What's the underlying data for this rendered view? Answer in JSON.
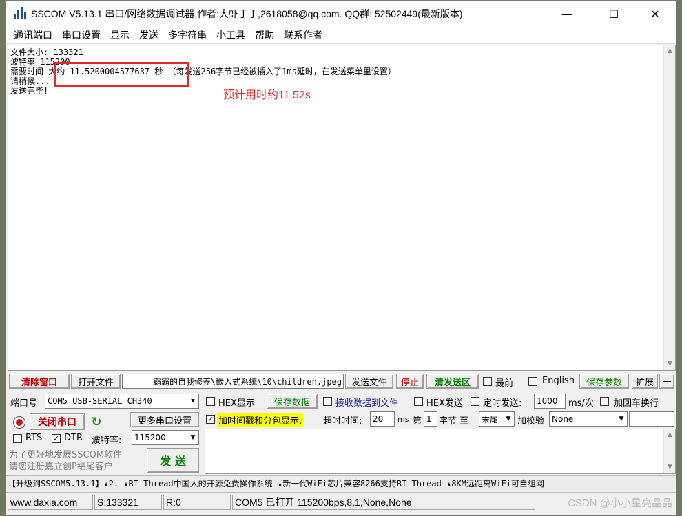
{
  "window": {
    "title": "SSCOM V5.13.1 串口/网络数据调试器,作者:大虾丁丁,2618058@qq.com. QQ群: 52502449(最新版本)"
  },
  "menu": [
    "通讯端口",
    "串口设置",
    "显示",
    "发送",
    "多字符串",
    "小工具",
    "帮助",
    "联系作者"
  ],
  "receive": {
    "text": "文件大小: 133321\n波特率 115200\n需要时间 大约 11.5200004577637 秒 （每发送256字节已经被插入了1ms延时，在发送菜单里设置）\n请稍候...\n发送完毕!",
    "annotation": "预计用时约11.52s"
  },
  "toolbar": {
    "clear_window": "清除窗口",
    "open_file": "打开文件",
    "file_path": "霸霸的自我修养\\嵌入式系统\\10\\children.jpeg",
    "send_file": "发送文件",
    "stop": "停止",
    "clear_send_area": "清发送区",
    "topmost": "最前",
    "english": "English",
    "save_params": "保存参数",
    "expand": "扩展",
    "collapse": "—"
  },
  "port": {
    "port_label": "端口号",
    "port_value": "COM5 USB-SERIAL CH340",
    "close_port": "关闭串口",
    "more_settings": "更多串口设置",
    "rts": "RTS",
    "dtr": "DTR",
    "baud_label": "波特率:",
    "baud_value": "115200",
    "promo": "为了更好地发展SSCOM软件\n请您注册嘉立创P结尾客户"
  },
  "options": {
    "hex_display": "HEX显示",
    "save_data": "保存数据",
    "recv_to_file": "接收数据到文件",
    "hex_send": "HEX发送",
    "timed_send": "定时发送:",
    "interval": "1000",
    "interval_unit": "ms/次",
    "add_crlf": "加回车换行",
    "timestamp": "加时间戳和分包显示,",
    "timeout_label": "超时时间:",
    "timeout_value": "20",
    "ms": "ms",
    "nth": "第",
    "nth_value": "1",
    "byte_to": "字节 至",
    "end": "末尾",
    "checksum_label": "加校验",
    "checksum_value": "None"
  },
  "send_button": "发 送",
  "ad": "【升级到SSCOM5.13.1】★2. ★RT-Thread中国人的开源免费操作系统 ★新一代WiFi芯片兼容8266支持RT-Thread ★8KM远距离WiFi可自组网",
  "status": {
    "site": "www.daxia.com",
    "sent": "S:133321",
    "received": "R:0",
    "port_status": "COM5 已打开  115200bps,8,1,None,None"
  },
  "watermark": "CSDN @小小星亮晶晶",
  "colors": {
    "highlight": "#e8262b",
    "accent_red": "#c00000",
    "accent_green": "#008000",
    "timestamp_bg": "#ffff00"
  }
}
